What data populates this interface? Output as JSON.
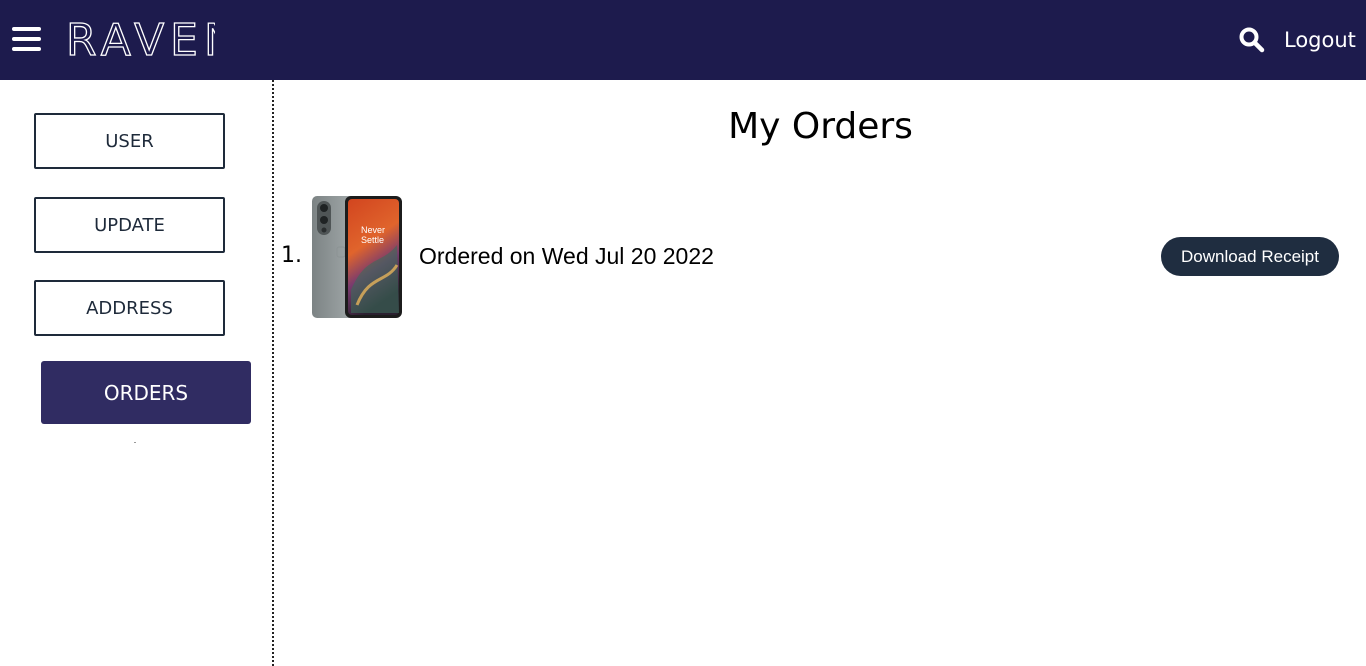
{
  "header": {
    "brand": "RAVEN",
    "logout_label": "Logout",
    "menu_icon": "hamburger-menu-icon",
    "search_icon": "search-icon",
    "background_color": "#1d1b4d"
  },
  "sidebar": {
    "items": [
      {
        "label": "USER",
        "active": false
      },
      {
        "label": "UPDATE",
        "active": false
      },
      {
        "label": "ADDRESS",
        "active": false
      },
      {
        "label": "ORDERS",
        "active": true
      }
    ],
    "active_color": "#302c62"
  },
  "main": {
    "title": "My Orders",
    "orders": [
      {
        "index": "1.",
        "product_image_text": "Never Settle",
        "ordered_text": "Ordered on Wed Jul 20 2022",
        "receipt_label": "Download Receipt"
      }
    ],
    "receipt_button_color": "#1f2d40"
  }
}
